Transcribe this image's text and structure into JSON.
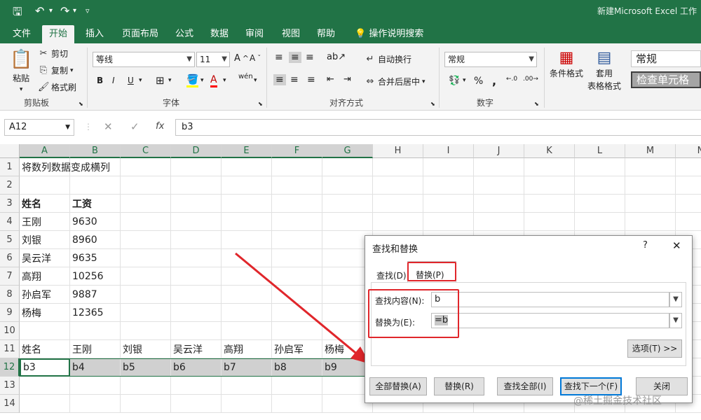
{
  "window": {
    "title": "新建Microsoft Excel 工作"
  },
  "ribbon_tabs": [
    "文件",
    "开始",
    "插入",
    "页面布局",
    "公式",
    "数据",
    "审阅",
    "视图",
    "帮助",
    "操作说明搜索"
  ],
  "clipboard": {
    "paste": "粘贴",
    "cut": "剪切",
    "copy": "复制",
    "format_painter": "格式刷",
    "label": "剪贴板"
  },
  "font": {
    "name": "等线",
    "size": "11",
    "bold": "B",
    "italic": "I",
    "underline": "U",
    "wen": "wén",
    "label": "字体"
  },
  "alignment": {
    "wrap": "自动换行",
    "merge": "合并后居中",
    "label": "对齐方式"
  },
  "number": {
    "format": "常规",
    "label": "数字",
    "percent": "%",
    "comma": ","
  },
  "styles": {
    "cond": "条件格式",
    "table1": "套用",
    "table2": "表格格式",
    "style_normal": "常规",
    "style_check": "检查单元格"
  },
  "formula_bar": {
    "name_box": "A12",
    "fx": "fx",
    "content": "b3"
  },
  "columns": [
    "A",
    "B",
    "C",
    "D",
    "E",
    "F",
    "G",
    "H",
    "I",
    "J",
    "K",
    "L",
    "M",
    "N"
  ],
  "rows": [
    "1",
    "2",
    "3",
    "4",
    "5",
    "6",
    "7",
    "8",
    "9",
    "10",
    "11",
    "12",
    "13",
    "14"
  ],
  "cells": {
    "r1": [
      "将数列数据变成横列"
    ],
    "r3": [
      "姓名",
      "工资"
    ],
    "r4": [
      "王刚",
      "9630"
    ],
    "r5": [
      "刘银",
      "8960"
    ],
    "r6": [
      "吴云洋",
      "9635"
    ],
    "r7": [
      "高翔",
      "10256"
    ],
    "r8": [
      "孙启军",
      "9887"
    ],
    "r9": [
      "杨梅",
      "12365"
    ],
    "r11": [
      "姓名",
      "王刚",
      "刘银",
      "吴云洋",
      "高翔",
      "孙启军",
      "杨梅"
    ],
    "r12": [
      "b3",
      "b4",
      "b5",
      "b6",
      "b7",
      "b8",
      "b9"
    ]
  },
  "dialog": {
    "title": "查找和替换",
    "help": "?",
    "close": "✕",
    "tab_find": "查找(D)",
    "tab_replace": "替换(P)",
    "find_label": "查找内容(N):",
    "find_value": "b",
    "replace_label": "替换为(E):",
    "replace_value": "=b",
    "options": "选项(T) >>",
    "replace_all": "全部替换(A)",
    "replace": "替换(R)",
    "find_all": "查找全部(I)",
    "find_next": "查找下一个(F)",
    "close_btn": "关闭"
  },
  "watermark": "@稀土掘金技术社区",
  "colors": {
    "accent": "#217346",
    "annotation": "#e0262b"
  }
}
